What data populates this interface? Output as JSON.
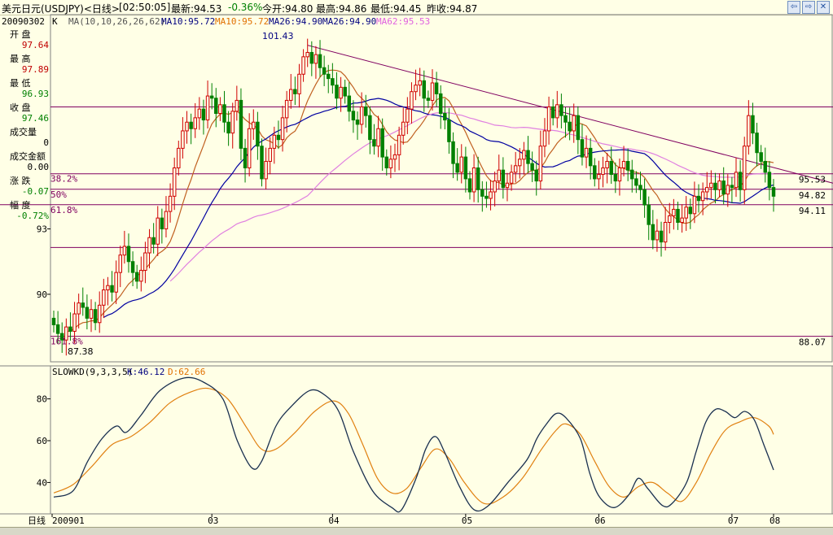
{
  "header": {
    "symbol": "美元日元(USDJPY)<日线>",
    "time": "[02:50:05]",
    "latest": "最新:94.53",
    "change_pct": "-0.36%",
    "open": "今开:94.80",
    "high": "最高:94.86",
    "low": "最低:94.45",
    "prev_close": "昨收:94.87"
  },
  "ma_legend": {
    "date": "20090302",
    "k": "K",
    "ma_params": "MA(10,10,26,26,62)",
    "ma10a": "MA10:95.72",
    "ma10b": "MA10:95.72",
    "ma26a": "MA26:94.90",
    "ma26b": "MA26:94.90",
    "ma62": "MA62:95.53"
  },
  "side_panel": [
    {
      "label": "开  盘",
      "value": "97.64",
      "color": "#c00000"
    },
    {
      "label": "最  高",
      "value": "97.89",
      "color": "#c00000"
    },
    {
      "label": "最  低",
      "value": "96.93",
      "color": "#008000"
    },
    {
      "label": "收  盘",
      "value": "97.46",
      "color": "#008000"
    },
    {
      "label": "成交量",
      "value": "0",
      "color": "#000000"
    },
    {
      "label": "成交金额",
      "value": "0.00",
      "color": "#000000"
    },
    {
      "label": "涨  跌",
      "value": "-0.07",
      "color": "#008000"
    },
    {
      "label": "幅  度",
      "value": "-0.72%",
      "color": "#008000"
    }
  ],
  "chart_data": {
    "type": "candlestick",
    "ylim": [
      86.9,
      102.2
    ],
    "y_ticks": [
      "93",
      "90"
    ],
    "x_ticks": [
      "200901",
      "03",
      "04",
      "05",
      "06",
      "07",
      "08"
    ],
    "high_label": "101.43",
    "low_label": "87.38",
    "fib_levels": [
      {
        "label": "38.2%",
        "right": "95.53"
      },
      {
        "label": "50%",
        "right": "94.82"
      },
      {
        "label": "61.8%",
        "right": "94.11"
      },
      {
        "label": "161.8%",
        "right": "88.07"
      }
    ],
    "fib_values": [
      98.6,
      95.53,
      94.82,
      94.11,
      92.15,
      88.07
    ],
    "candles_note": "approximate daily OHLC",
    "closes": [
      88.6,
      88.2,
      87.9,
      88.5,
      88.3,
      89.1,
      89.6,
      89.4,
      88.9,
      89.3,
      88.7,
      89.5,
      90.2,
      90.4,
      90.1,
      91.0,
      91.8,
      92.2,
      91.5,
      91.0,
      90.6,
      91.1,
      91.9,
      92.6,
      92.3,
      93.5,
      93.0,
      93.8,
      94.5,
      95.8,
      96.7,
      97.5,
      97.9,
      97.6,
      98.1,
      98.5,
      98.0,
      99.1,
      99.0,
      98.3,
      98.7,
      97.9,
      97.4,
      98.4,
      98.9,
      96.7,
      95.8,
      97.6,
      97.9,
      96.8,
      95.3,
      96.1,
      96.7,
      97.3,
      97.1,
      98.1,
      98.9,
      99.4,
      99.2,
      100.1,
      100.9,
      101.1,
      100.6,
      101.0,
      100.4,
      100.1,
      99.9,
      99.6,
      99.0,
      99.5,
      99.1,
      98.4,
      98.0,
      97.8,
      98.6,
      98.2,
      97.1,
      96.8,
      97.6,
      96.3,
      95.8,
      96.2,
      96.4,
      97.3,
      97.9,
      98.5,
      99.3,
      99.6,
      99.8,
      99.0,
      98.9,
      99.7,
      99.2,
      98.3,
      98.0,
      97.0,
      96.0,
      95.6,
      96.3,
      95.3,
      94.7,
      95.8,
      94.8,
      94.5,
      94.4,
      94.7,
      95.2,
      95.7,
      94.9,
      95.1,
      95.6,
      95.9,
      96.2,
      96.6,
      96.0,
      95.7,
      95.2,
      96.8,
      97.5,
      98.6,
      98.1,
      98.7,
      98.2,
      97.9,
      97.5,
      98.2,
      97.1,
      96.3,
      96.7,
      95.9,
      95.3,
      95.5,
      95.8,
      96.1,
      95.5,
      95.2,
      95.8,
      96.1,
      95.7,
      95.3,
      95.0,
      94.8,
      94.1,
      93.2,
      92.5,
      92.9,
      92.4,
      93.3,
      93.6,
      93.9,
      93.3,
      93.5,
      94.0,
      93.7,
      94.5,
      94.3,
      94.7,
      94.9,
      95.1,
      94.8,
      95.2,
      94.6,
      95.0,
      94.9,
      95.6,
      94.8,
      96.8,
      98.2,
      97.4,
      96.5,
      96.1,
      95.6,
      94.9,
      94.5
    ]
  },
  "stoch": {
    "title": "SLOWKD(9,3,3,5)",
    "k_label": "K:46.12",
    "d_label": "D:62.66",
    "ylim": [
      25,
      95
    ],
    "y_ticks": [
      "80",
      "60",
      "40"
    ],
    "k_knots": [
      [
        0,
        33
      ],
      [
        4,
        36
      ],
      [
        7,
        50
      ],
      [
        10,
        61
      ],
      [
        13,
        67
      ],
      [
        15,
        64
      ],
      [
        18,
        72
      ],
      [
        22,
        84
      ],
      [
        27,
        90
      ],
      [
        31,
        88
      ],
      [
        35,
        80
      ],
      [
        38,
        60
      ],
      [
        41,
        47
      ],
      [
        43,
        50
      ],
      [
        46,
        67
      ],
      [
        49,
        76
      ],
      [
        53,
        84
      ],
      [
        56,
        82
      ],
      [
        59,
        74
      ],
      [
        62,
        55
      ],
      [
        66,
        36
      ],
      [
        70,
        28
      ],
      [
        72,
        27
      ],
      [
        75,
        42
      ],
      [
        77,
        56
      ],
      [
        79,
        62
      ],
      [
        81,
        54
      ],
      [
        84,
        38
      ],
      [
        87,
        27
      ],
      [
        90,
        29
      ],
      [
        94,
        40
      ],
      [
        98,
        51
      ],
      [
        100,
        61
      ],
      [
        102,
        68
      ],
      [
        104,
        73
      ],
      [
        106,
        71
      ],
      [
        109,
        61
      ],
      [
        111,
        44
      ],
      [
        113,
        33
      ],
      [
        116,
        28
      ],
      [
        119,
        34
      ],
      [
        121,
        42
      ],
      [
        123,
        37
      ],
      [
        126,
        29
      ],
      [
        128,
        30
      ],
      [
        131,
        40
      ],
      [
        133,
        55
      ],
      [
        135,
        69
      ],
      [
        137,
        75
      ],
      [
        139,
        74
      ],
      [
        141,
        71
      ],
      [
        143,
        74
      ],
      [
        145,
        70
      ],
      [
        147,
        58
      ],
      [
        149,
        46
      ]
    ],
    "d_knots": [
      [
        0,
        35
      ],
      [
        4,
        39
      ],
      [
        8,
        48
      ],
      [
        12,
        58
      ],
      [
        16,
        62
      ],
      [
        20,
        69
      ],
      [
        24,
        78
      ],
      [
        28,
        83
      ],
      [
        32,
        85
      ],
      [
        36,
        80
      ],
      [
        40,
        66
      ],
      [
        43,
        56
      ],
      [
        46,
        56
      ],
      [
        50,
        64
      ],
      [
        54,
        74
      ],
      [
        58,
        79
      ],
      [
        61,
        73
      ],
      [
        64,
        58
      ],
      [
        67,
        42
      ],
      [
        70,
        35
      ],
      [
        73,
        37
      ],
      [
        76,
        47
      ],
      [
        79,
        56
      ],
      [
        82,
        51
      ],
      [
        85,
        40
      ],
      [
        89,
        30
      ],
      [
        93,
        33
      ],
      [
        97,
        42
      ],
      [
        101,
        56
      ],
      [
        104,
        65
      ],
      [
        106,
        68
      ],
      [
        109,
        63
      ],
      [
        112,
        50
      ],
      [
        115,
        38
      ],
      [
        118,
        33
      ],
      [
        121,
        38
      ],
      [
        124,
        40
      ],
      [
        127,
        35
      ],
      [
        130,
        31
      ],
      [
        133,
        40
      ],
      [
        136,
        54
      ],
      [
        139,
        65
      ],
      [
        142,
        69
      ],
      [
        145,
        71
      ],
      [
        148,
        67
      ],
      [
        149,
        63
      ]
    ]
  },
  "footer": {
    "day_label": "日线"
  }
}
